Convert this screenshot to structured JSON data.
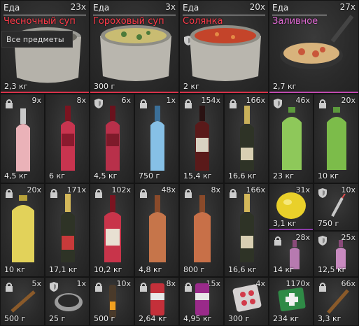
{
  "big_cards": [
    {
      "category": "Еда",
      "name": "Чесночный суп",
      "count": "23x",
      "weight": "2,3 кг",
      "name_color": "#ff3b4a"
    },
    {
      "category": "Еда",
      "name": "Гороховый суп",
      "count": "3x",
      "weight": "300 г",
      "name_color": "#ff3b4a"
    },
    {
      "category": "Еда",
      "name": "Солянка",
      "count": "20x",
      "weight": "2 кг",
      "name_color": "#ff3b4a"
    },
    {
      "category": "Еда",
      "name": "Заливное",
      "count": "27x",
      "weight": "2,7 кг",
      "name_color": "#e36ad6"
    }
  ],
  "tooltip": "Все предметы",
  "row1": [
    {
      "count": "9x",
      "weight": "4,5 кг",
      "badge": "lock"
    },
    {
      "count": "8x",
      "weight": "6 кг",
      "badge": ""
    },
    {
      "count": "6x",
      "weight": "4,5 кг",
      "badge": "shield"
    },
    {
      "count": "1x",
      "weight": "750 г",
      "badge": "lock"
    },
    {
      "count": "154x",
      "weight": "15,4 кг",
      "badge": "lock"
    },
    {
      "count": "166x",
      "weight": "16,6 кг",
      "badge": "lock"
    },
    {
      "count": "46x",
      "weight": "23 кг",
      "badge": "shield"
    },
    {
      "count": "20x",
      "weight": "10 кг",
      "badge": "lock"
    }
  ],
  "row2": [
    {
      "count": "20x",
      "weight": "10 кг",
      "badge": "lock"
    },
    {
      "count": "171x",
      "weight": "17,1 кг",
      "badge": "lock"
    },
    {
      "count": "102x",
      "weight": "10,2 кг",
      "badge": "lock"
    },
    {
      "count": "48x",
      "weight": "4,8 кг",
      "badge": "lock"
    },
    {
      "count": "8x",
      "weight": "800 г",
      "badge": "lock"
    },
    {
      "count": "166x",
      "weight": "16,6 кг",
      "badge": "lock"
    },
    {
      "count": "31x",
      "weight": "3,1 кг",
      "badge": ""
    },
    {
      "count": "10x",
      "weight": "750 г",
      "badge": "shield"
    },
    {
      "count": "28x",
      "weight": "14 кг",
      "badge": "lock"
    },
    {
      "count": "25x",
      "weight": "12,5 кг",
      "badge": "shield"
    }
  ],
  "row3": [
    {
      "count": "5x",
      "weight": "500 г",
      "badge": "lock"
    },
    {
      "count": "1x",
      "weight": "25 г",
      "badge": "shield"
    },
    {
      "count": "10x",
      "weight": "500 г",
      "badge": "lock"
    },
    {
      "count": "8x",
      "weight": "2,64 кг",
      "badge": "lock"
    },
    {
      "count": "15x",
      "weight": "4,95 кг",
      "badge": "lock"
    },
    {
      "count": "4x",
      "weight": "300 г",
      "badge": ""
    },
    {
      "count": "1170x",
      "weight": "234 кг",
      "badge": ""
    },
    {
      "count": "66x",
      "weight": "3,3 кг",
      "badge": "lock"
    }
  ],
  "colors": {
    "red_stripe": "#d8324a",
    "pink_stripe": "#c04ab0",
    "purple_stripe": "#8a3aa8"
  }
}
